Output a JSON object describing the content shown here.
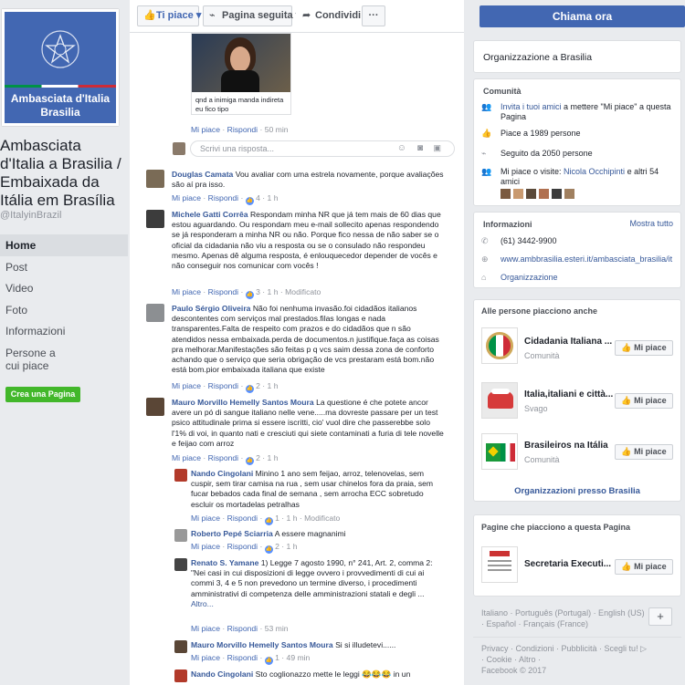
{
  "page": {
    "name": "Ambasciata d'Italia a Brasilia / Embaixada da Itália em Brasília",
    "handle": "@ItalyinBrazil",
    "profile_text_line1": "Ambasciata d'Italia",
    "profile_text_line2": "Brasilia"
  },
  "nav": [
    "Home",
    "Post",
    "Video",
    "Foto",
    "Informazioni",
    "Persone a cui piace"
  ],
  "create_page": "Crea una Pagina",
  "topbar": {
    "like": "Ti piace",
    "follow": "Pagina seguita",
    "share": "Condividi",
    "more": "···",
    "call": "Chiama ora"
  },
  "post_image": {
    "caption": "qnd a inimiga manda indireta eu fico tipo",
    "meta_like": "Mi piace",
    "meta_reply": "Rispondi",
    "meta_time": "50 min"
  },
  "reply_input": {
    "placeholder": "Scrivi una risposta..."
  },
  "comments": [
    {
      "name": "Douglas Camata",
      "text": "Vou avaliar com uma estrela novamente, porque avaliações são aí pra isso.",
      "like": "Mi piace",
      "reply": "Rispondi",
      "count": "4",
      "time": "1 h",
      "edited": ""
    },
    {
      "name": "Michele Gatti Corrêa",
      "text": "Respondam minha NR que já tem mais de 60 dias que estou aguardando. Ou respondam meu e-mail sollecito apenas respondendo se já responderam a minha NR ou não. Porque fico nessa de não saber se o oficial da cidadania não viu a resposta ou se o consulado não respondeu mesmo. Apenas dê alguma resposta, é enlouquecedor depender de vocês e não conseguir nos comunicar com vocês !",
      "like": "Mi piace",
      "reply": "Rispondi",
      "count": "3",
      "time": "1 h",
      "edited": "Modificato"
    },
    {
      "name": "Paulo Sérgio Oliveira",
      "text": "Não foi nenhuma invasão.foi cidadãos italianos descontentes com serviços mal prestados.filas longas e nada transparentes.Falta de respeito com prazos e do cidadãos que n são atendidos nessa embaixada.perda de documentos.n justifique.faça as coisas pra melhorar.Manifestações são feitas p q vcs saim dessa zona de conforto achando que o serviço que seria obrigação de vcs prestaram está bom.não está bom.pior embaixada italiana que existe",
      "like": "Mi piace",
      "reply": "Rispondi",
      "count": "2",
      "time": "1 h",
      "edited": ""
    },
    {
      "name": "Mauro Morvillo Hemelly Santos Moura",
      "text": "La questione é che potete ancor avere un pó di sangue italiano nelle vene.....ma dovreste passare per un test psico attitudinale prima si essere iscritti, cio' vuol dire che passerebbe solo l'1% di voi, in quanto nati e cresciuti qui siete contaminati a furia di tele novelle e feijao com arroz",
      "like": "Mi piace",
      "reply": "Rispondi",
      "count": "2",
      "time": "1 h",
      "edited": ""
    }
  ],
  "replies": [
    {
      "name": "Nando Cingolani",
      "text": "Minino 1 ano sem feijao, arroz, telenovelas, sem cuspir, sem tirar camisa na rua , sem usar chinelos fora da praia, sem fucar bebados cada final de semana , sem arrocha ECC sobretudo escluir os mortadelas petralhas",
      "like": "Mi piace",
      "reply": "Rispondi",
      "count": "1",
      "time": "1 h",
      "edited": "Modificato"
    },
    {
      "name": "Roberto Pepé Sciarria",
      "text": "A essere magnanimi",
      "like": "Mi piace",
      "reply": "Rispondi",
      "count": "2",
      "time": "1 h",
      "edited": ""
    },
    {
      "name": "Renato S. Yamane",
      "text": "1) Legge 7 agosto 1990, n° 241, Art. 2, comma 2:\n\"Nei casi in cui disposizioni di legge ovvero i provvedimenti di cui ai commi 3, 4 e 5 non prevedono un termine diverso, i procedimenti amministrativi di competenza delle amministrazioni statali e degli ...",
      "more": "Altro...",
      "like": "Mi piace",
      "reply": "Rispondi",
      "count": "",
      "time": "53 min",
      "edited": ""
    },
    {
      "name": "Mauro Morvillo Hemelly Santos Moura",
      "text": "Si si illudetevi......",
      "like": "Mi piace",
      "reply": "Rispondi",
      "count": "1",
      "time": "49 min",
      "edited": ""
    },
    {
      "name": "Nando Cingolani",
      "text": "Sto coglionazzo mette le leggi 😂😂😂 in un",
      "like": "",
      "reply": "",
      "count": "",
      "time": "",
      "edited": ""
    }
  ],
  "right": {
    "org": "Organizzazione a Brasilia",
    "community_title": "Comunità",
    "invite_link": "Invita i tuoi amici",
    "invite_rest": " a mettere \"Mi piace\" a questa Pagina",
    "likes": "Piace a 1989 persone",
    "follows": "Seguito da 2050 persone",
    "friends_pre": "Mi piace o visite: ",
    "friends_link": "Nicola Occhipinti",
    "friends_rest": " e altri 54 amici",
    "info_title": "Informazioni",
    "info_all": "Mostra tutto",
    "phone": "(61) 3442-9900",
    "website": "www.ambbrasilia.esteri.it/ambasciata_brasilia/it",
    "org_link": "Organizzazione",
    "also_title": "Alle persone piacciono anche",
    "also": [
      {
        "name": "Cidadania Italiana ...",
        "cat": "Comunità",
        "btn": "Mi piace"
      },
      {
        "name": "Italia,italiani e città...",
        "cat": "Svago",
        "btn": "Mi piace"
      },
      {
        "name": "Brasileiros na Itália",
        "cat": "Comunità",
        "btn": "Mi piace"
      }
    ],
    "more_orgs": "Organizzazioni presso Brasilia",
    "liked_title": "Pagine che piacciono a questa Pagina",
    "liked": {
      "name": "Secretaria Executi...",
      "btn": "Mi piace"
    }
  },
  "footer": {
    "langs1": "Italiano · Português (Portugal) · English (US)",
    "langs2": "· Español · Français (France)",
    "add": "+",
    "links": "Privacy · Condizioni · Pubblicità · Scegli tu! ▷",
    "links2": "· Cookie · Altro ·",
    "copy": "Facebook © 2017"
  }
}
